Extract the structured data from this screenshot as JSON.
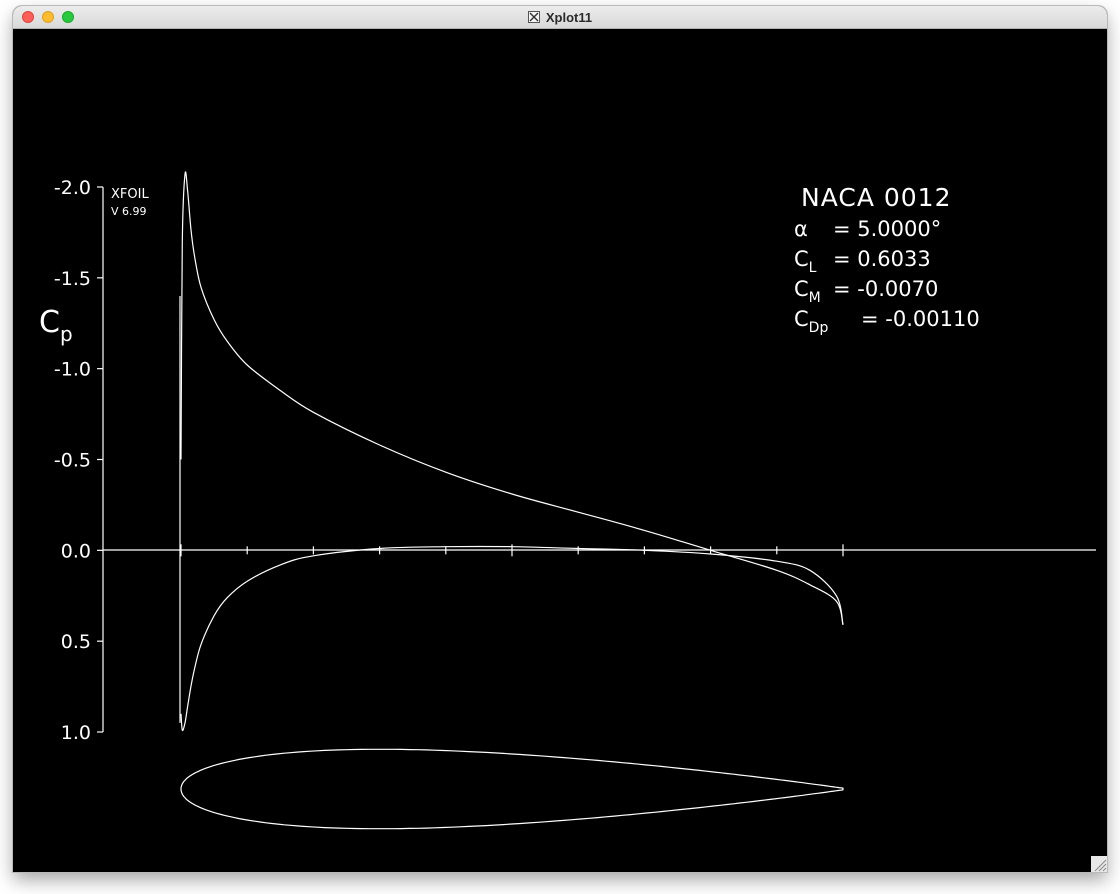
{
  "window": {
    "title": "Xplot11",
    "title_icon": "x11-icon"
  },
  "plot": {
    "program": "XFOIL",
    "version": "V 6.99",
    "airfoil": "NACA 0012",
    "y_axis_label": "C",
    "y_axis_label_sub": "p",
    "results": {
      "alpha_symbol": "α",
      "alpha_value": "=  5.0000°",
      "cl_symbol": "C",
      "cl_sub": "L",
      "cl_value": "=  0.6033",
      "cm_symbol": "C",
      "cm_sub": "M",
      "cm_value": "= -0.0070",
      "cdp_symbol": "C",
      "cdp_sub": "Dp",
      "cdp_value": "= -0.00110"
    }
  },
  "chart_data": {
    "type": "line",
    "title": "NACA 0012",
    "xlabel": "",
    "ylabel": "Cp",
    "y_inverted": true,
    "ylim": [
      -2.0,
      1.0
    ],
    "xlim": [
      0.0,
      1.0
    ],
    "y_ticks": [
      "-2.0",
      "-1.5",
      "-1.0",
      "-0.5",
      "0.0",
      "0.5",
      "1.0"
    ],
    "x_ticks": [
      0.0,
      0.1,
      0.2,
      0.3,
      0.4,
      0.5,
      0.6,
      0.7,
      0.8,
      0.9,
      1.0
    ],
    "series": [
      {
        "x": [
          0.0,
          0.002,
          0.006,
          0.01,
          0.015,
          0.02,
          0.03,
          0.05,
          0.07,
          0.1,
          0.15,
          0.2,
          0.3,
          0.4,
          0.5,
          0.6,
          0.7,
          0.8,
          0.9,
          0.95,
          0.99,
          1.0
        ],
        "y": [
          -0.5,
          -1.7,
          -2.07,
          -1.98,
          -1.77,
          -1.63,
          -1.45,
          -1.27,
          -1.15,
          -1.02,
          -0.88,
          -0.76,
          -0.58,
          -0.43,
          -0.31,
          -0.21,
          -0.11,
          0.0,
          0.11,
          0.19,
          0.28,
          0.41
        ]
      },
      {
        "x": [
          0.0,
          0.002,
          0.006,
          0.01,
          0.015,
          0.02,
          0.03,
          0.05,
          0.07,
          0.1,
          0.15,
          0.2,
          0.3,
          0.4,
          0.5,
          0.6,
          0.7,
          0.8,
          0.9,
          0.95,
          0.99,
          1.0
        ],
        "y": [
          0.9,
          0.99,
          0.95,
          0.86,
          0.75,
          0.66,
          0.52,
          0.36,
          0.26,
          0.17,
          0.08,
          0.03,
          -0.01,
          -0.02,
          -0.02,
          -0.01,
          0.0,
          0.02,
          0.06,
          0.11,
          0.25,
          0.41
        ]
      }
    ],
    "airfoil_thickness": 0.12,
    "grid": false,
    "legend": "none"
  },
  "colors": {
    "background": "#000000",
    "foreground": "#ffffff"
  }
}
